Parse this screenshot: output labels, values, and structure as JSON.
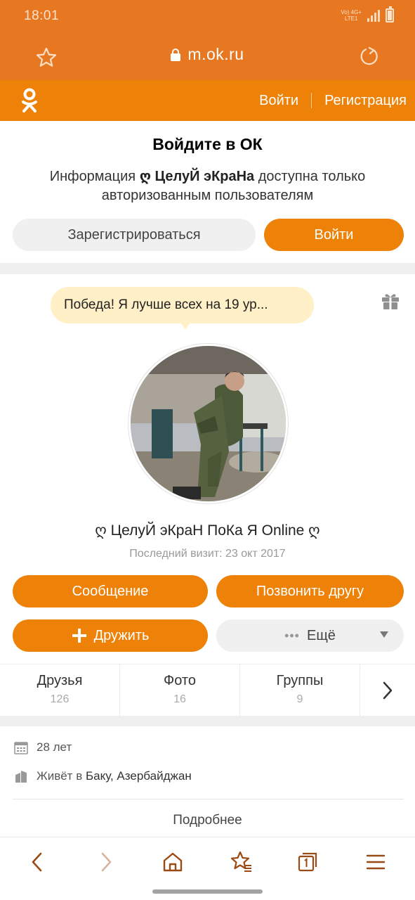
{
  "status_bar": {
    "time": "18:01",
    "network_top": "Vo) 4G+",
    "network_bottom": "LTE1"
  },
  "browser": {
    "url": "m.ok.ru"
  },
  "ok_header": {
    "login": "Войти",
    "register": "Регистрация"
  },
  "login_prompt": {
    "title": "Войдите в ОК",
    "text_before": "Информация ",
    "profile_name": "ღ ЦелуЙ эКраНа",
    "text_after": " доступна только авторизованным пользователям",
    "register_button": "Зарегистрироваться",
    "login_button": "Войти"
  },
  "profile": {
    "status": "Победа! Я лучше всех на 19 ур...",
    "name": "ღ ЦелуЙ эКраН ПоКа Я Online ღ",
    "last_visit": "Последний визит: 23 окт 2017",
    "message_button": "Сообщение",
    "call_button": "Позвонить другу",
    "befriend_button": "Дружить",
    "more_button": "Ещё",
    "stats": [
      {
        "label": "Друзья",
        "value": "126"
      },
      {
        "label": "Фото",
        "value": "16"
      },
      {
        "label": "Группы",
        "value": "9"
      }
    ],
    "age": "28 лет",
    "lives_prefix": "Живёт в ",
    "lives_place": "Баку, Азербайджан",
    "details_link": "Подробнее"
  },
  "colors": {
    "browser_bar": "#e87722",
    "ok_orange": "#ee8208",
    "bubble": "#fff0c7"
  }
}
